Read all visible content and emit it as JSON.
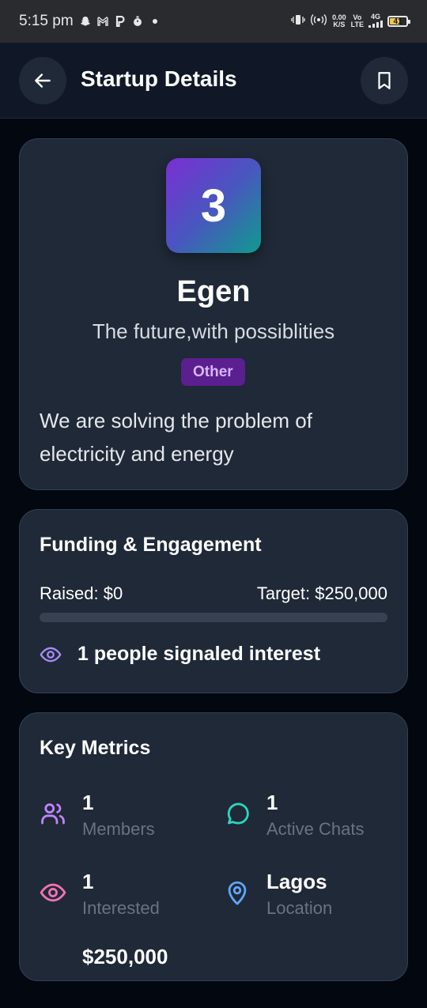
{
  "status_bar": {
    "time": "5:15 pm",
    "net_speed_value": "0.00",
    "net_speed_unit": "K/S",
    "volte_top": "Vo",
    "volte_bottom": "LTE",
    "network": "4G",
    "battery": "41"
  },
  "header": {
    "title": "Startup Details"
  },
  "profile": {
    "logo_text": "3",
    "name": "Egen",
    "tagline": "The future,with possiblities",
    "category": "Other",
    "description": "We are solving the problem of electricity and energy"
  },
  "funding": {
    "title": "Funding & Engagement",
    "raised": "Raised: $0",
    "target": "Target: $250,000",
    "progress_fraction": 0,
    "interest_text": "1 people signaled interest"
  },
  "metrics": {
    "title": "Key Metrics",
    "items": [
      {
        "value": "1",
        "label": "Members",
        "icon": "users-icon",
        "color": "#c084fc"
      },
      {
        "value": "1",
        "label": "Active Chats",
        "icon": "chat-icon",
        "color": "#2dd4bf"
      },
      {
        "value": "1",
        "label": "Interested",
        "icon": "eye-icon",
        "color": "#f472b6"
      },
      {
        "value": "Lagos",
        "label": "Location",
        "icon": "map-pin-icon",
        "color": "#60a5fa"
      },
      {
        "value": "$250,000",
        "label": "",
        "icon": "",
        "color": "#ffffff"
      }
    ]
  },
  "colors": {
    "background": "#03070f",
    "card": "#1f2937",
    "accent_purple": "#a78bfa",
    "badge_bg": "#5b1f8f",
    "badge_text": "#d9b5ff"
  }
}
